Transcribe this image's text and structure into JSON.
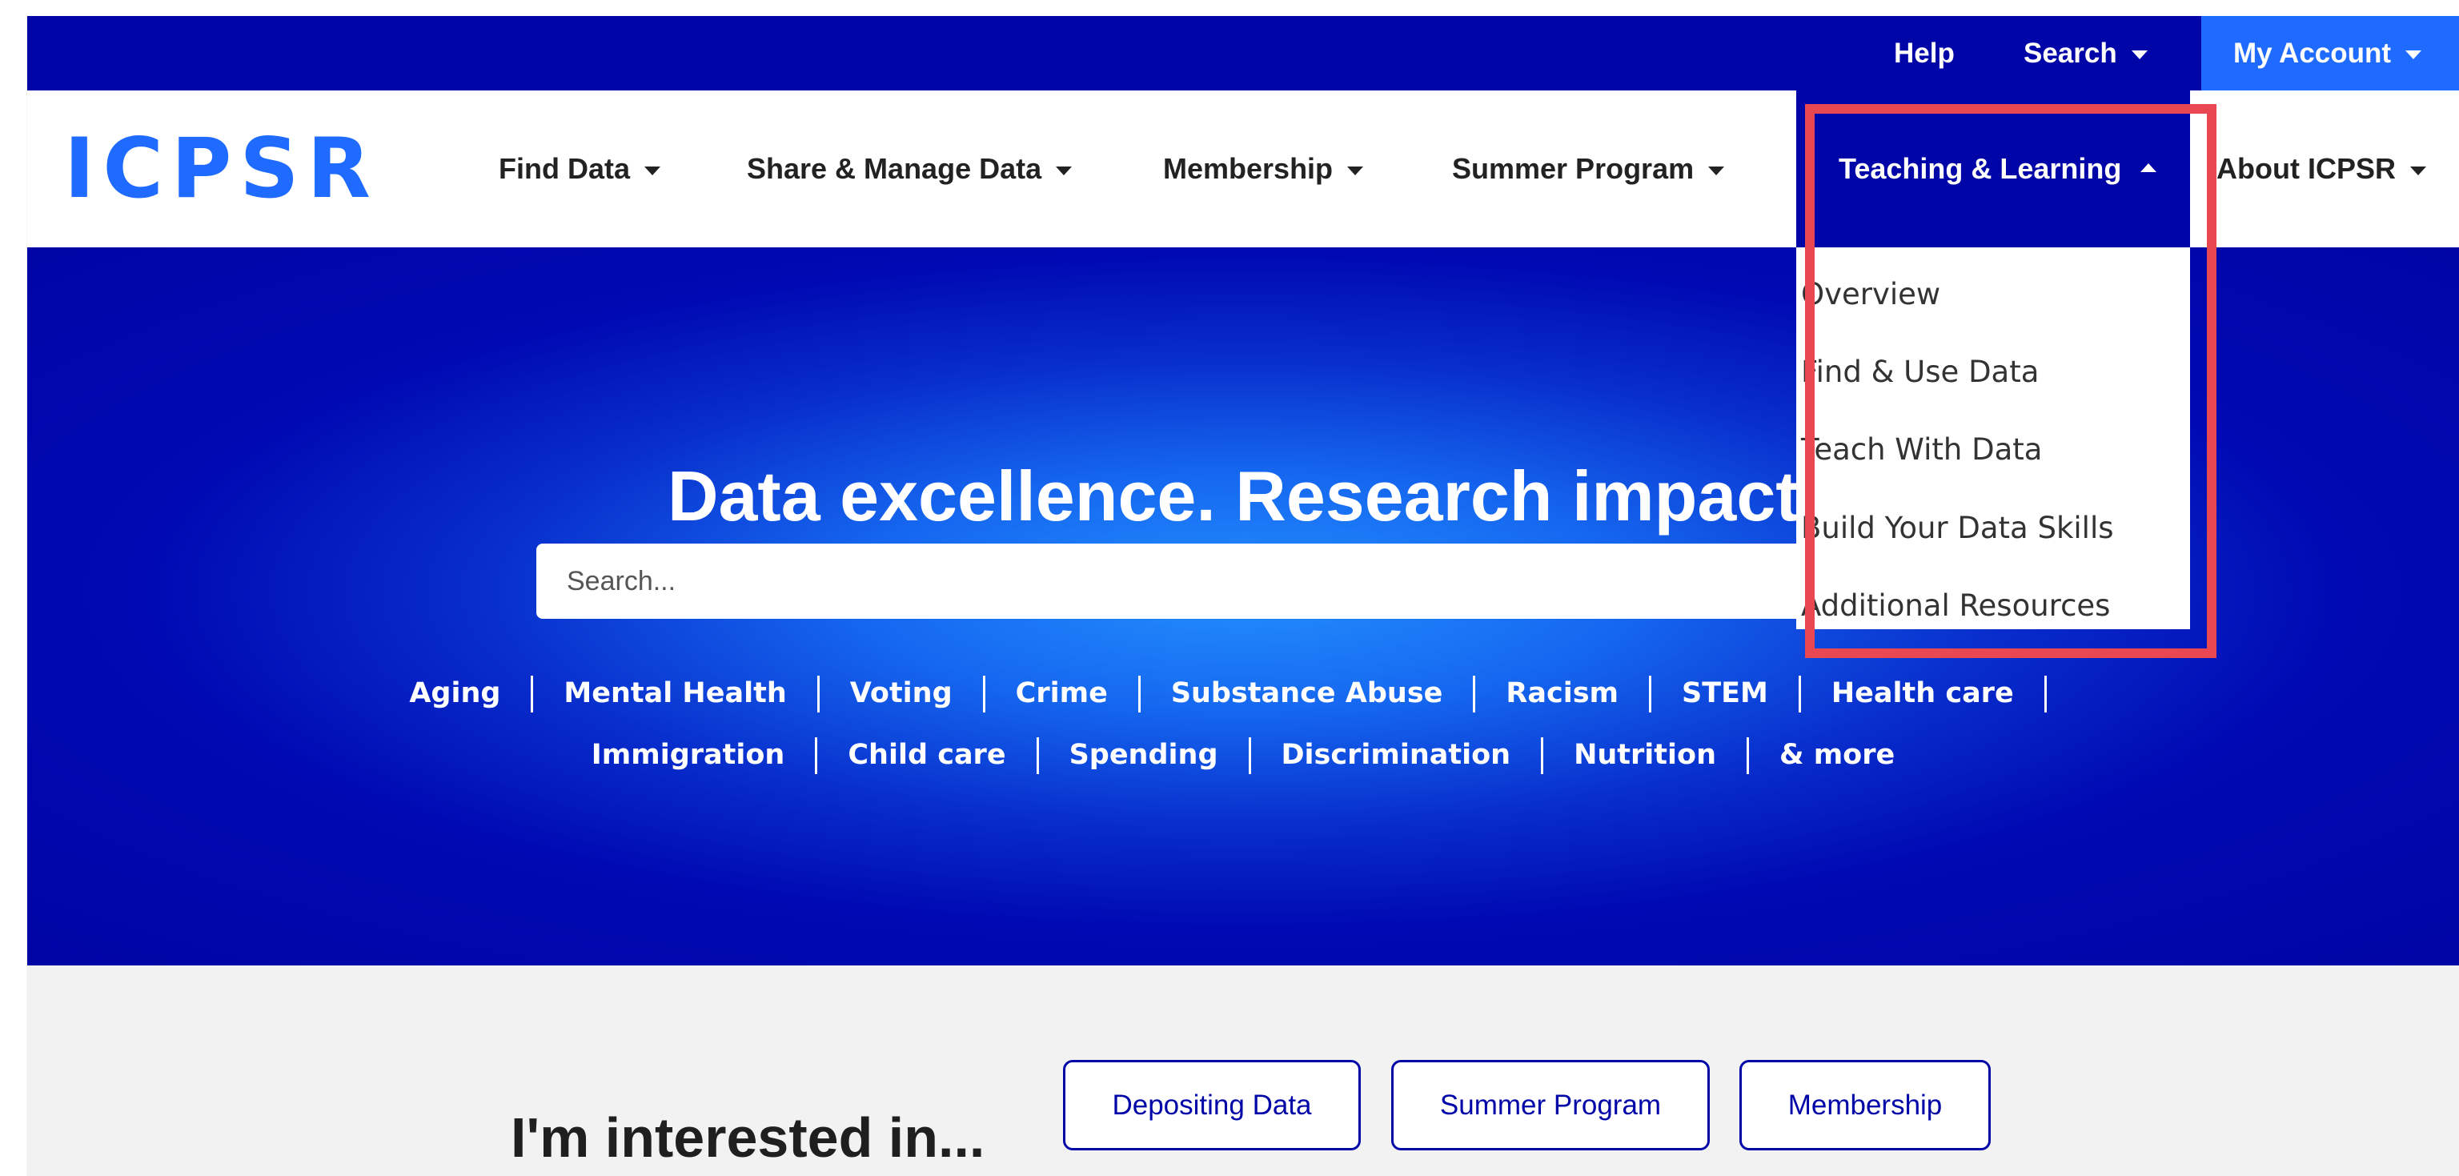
{
  "utility_bar": {
    "help": "Help",
    "search": "Search",
    "my_account": "My Account"
  },
  "brand": {
    "logo": "ICPSR"
  },
  "main_nav": {
    "items": [
      "Find Data",
      "Share & Manage Data",
      "Membership",
      "Summer Program",
      "Teaching & Learning",
      "About ICPSR"
    ]
  },
  "dropdown": {
    "items": [
      "Overview",
      "Find & Use Data",
      "Teach With Data",
      "Build Your Data Skills",
      "Additional Resources"
    ]
  },
  "hero": {
    "title": "Data excellence. Research impact.",
    "search_placeholder": "Search..."
  },
  "topics": {
    "row1": [
      "Aging",
      "Mental Health",
      "Voting",
      "Crime",
      "Substance Abuse",
      "Racism",
      "STEM",
      "Health care"
    ],
    "row2": [
      "Immigration",
      "Child care",
      "Spending",
      "Discrimination",
      "Nutrition",
      "& more"
    ]
  },
  "interested": {
    "title": "I'm interested in...",
    "buttons": [
      "Depositing Data",
      "Summer Program",
      "Membership"
    ]
  },
  "colors": {
    "brand_blue": "#0005a8",
    "accent_blue": "#1f6bff",
    "highlight_red": "#e94852"
  }
}
